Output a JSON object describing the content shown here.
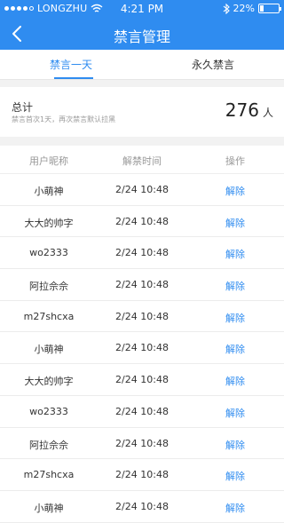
{
  "status_bar": {
    "carrier": "LONGZHU",
    "time": "4:21 PM",
    "battery_text": "22%",
    "battery_level": 0.22
  },
  "nav": {
    "title": "禁言管理"
  },
  "tabs": [
    {
      "label": "禁言一天",
      "active": true
    },
    {
      "label": "永久禁言",
      "active": false
    }
  ],
  "summary": {
    "title": "总计",
    "note": "禁言首次1天，再次禁言默认拉黑",
    "count": "276",
    "unit": "人"
  },
  "table": {
    "headers": [
      "用户昵称",
      "解禁时间",
      "操作"
    ],
    "rows": [
      {
        "name": "小萌神",
        "time": "2/24 10:48",
        "action": "解除"
      },
      {
        "name": "大大的帅字",
        "time": "2/24 10:48",
        "action": "解除"
      },
      {
        "name": "wo2333",
        "time": "2/24 10:48",
        "action": "解除"
      },
      {
        "name": "阿拉佘佘",
        "time": "2/24 10:48",
        "action": "解除"
      },
      {
        "name": "m27shcxa",
        "time": "2/24 10:48",
        "action": "解除"
      },
      {
        "name": "小萌神",
        "time": "2/24 10:48",
        "action": "解除"
      },
      {
        "name": "大大的帅字",
        "time": "2/24 10:48",
        "action": "解除"
      },
      {
        "name": "wo2333",
        "time": "2/24 10:48",
        "action": "解除"
      },
      {
        "name": "阿拉佘佘",
        "time": "2/24 10:48",
        "action": "解除"
      },
      {
        "name": "m27shcxa",
        "time": "2/24 10:48",
        "action": "解除"
      },
      {
        "name": "小萌神",
        "time": "2/24 10:48",
        "action": "解除"
      }
    ]
  },
  "colors": {
    "accent": "#2f8cf0",
    "background_gap": "#f2f2f2"
  },
  "icons": {
    "back": "chevron-left-icon",
    "wifi": "wifi-icon",
    "bluetooth": "bluetooth-icon",
    "battery": "battery-icon"
  }
}
